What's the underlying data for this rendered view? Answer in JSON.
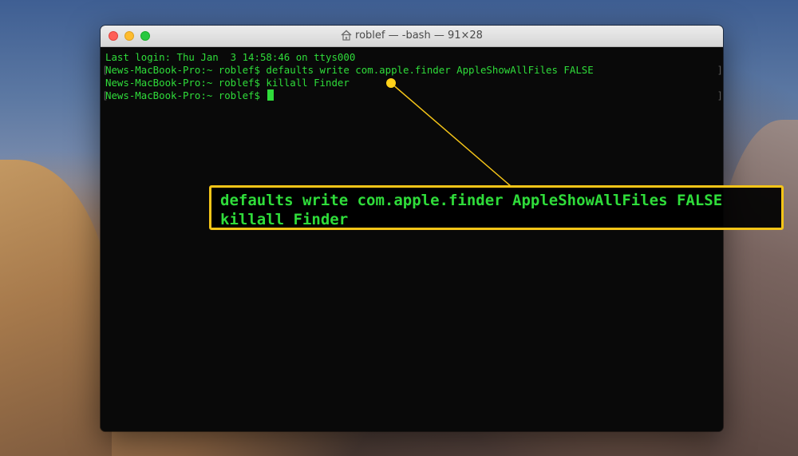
{
  "window": {
    "title": "roblef — -bash — 91×28"
  },
  "terminal": {
    "lines": [
      {
        "text": "Last login: Thu Jan  3 14:58:46 on ttys000"
      },
      {
        "text": "News-MacBook-Pro:~ roblef$ defaults write com.apple.finder AppleShowAllFiles FALSE"
      },
      {
        "text": "News-MacBook-Pro:~ roblef$ killall Finder"
      },
      {
        "text": "News-MacBook-Pro:~ roblef$ "
      }
    ]
  },
  "callout": {
    "line1": "defaults write com.apple.finder AppleShowAllFiles FALSE",
    "line2": "killall Finder"
  },
  "colors": {
    "terminal_text": "#2fdc3a",
    "callout_border": "#f5c518",
    "close": "#fe5f57",
    "minimize": "#febc2e",
    "zoom": "#28c840"
  },
  "icons": {
    "title_icon": "home-icon"
  }
}
